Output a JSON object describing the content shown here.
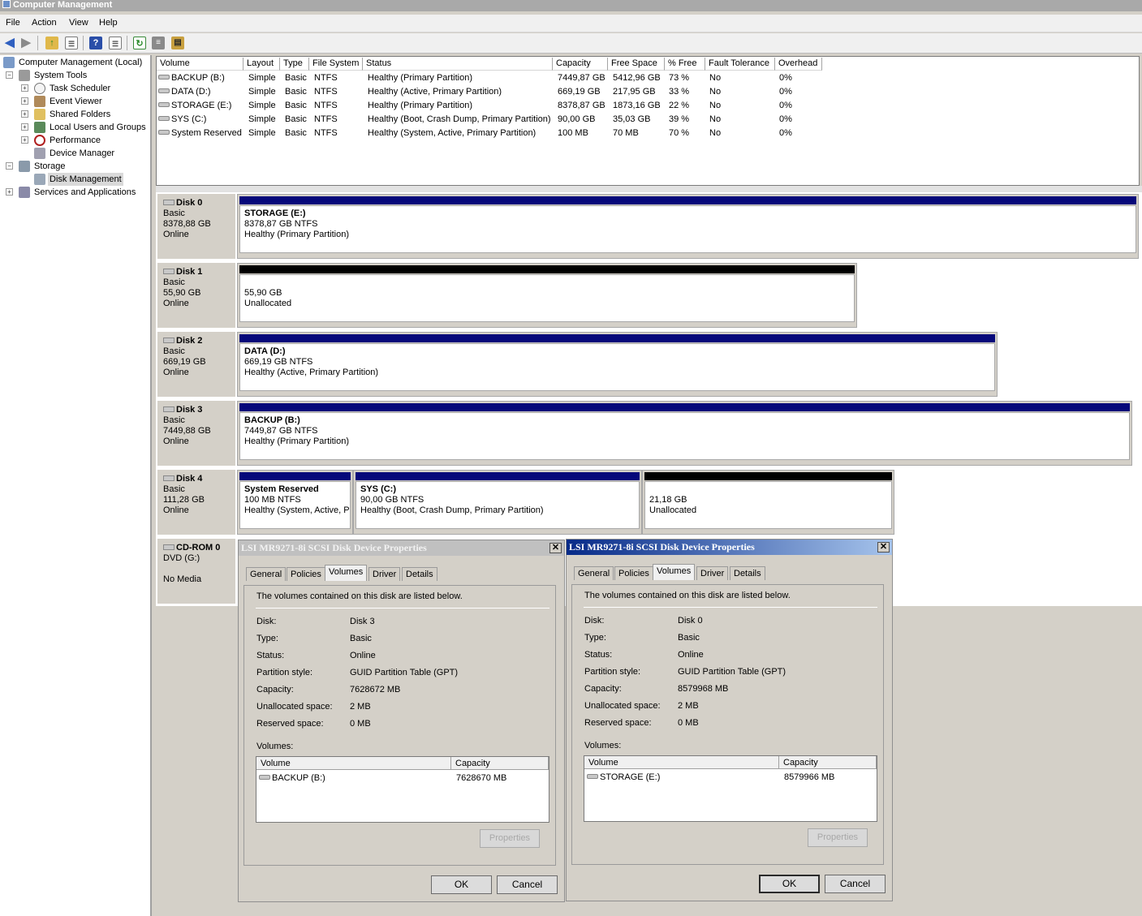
{
  "window": {
    "title": "Computer Management"
  },
  "menu": [
    "File",
    "Action",
    "View",
    "Help"
  ],
  "toolbar": {
    "icons": [
      "back-icon",
      "forward-icon",
      "up-folder-icon",
      "show-hide-tree-icon",
      "help-icon",
      "console-icon",
      "refresh-icon",
      "properties-icon",
      "export-icon"
    ]
  },
  "tree": {
    "root": "Computer Management (Local)",
    "system_tools": "System Tools",
    "task_scheduler": "Task Scheduler",
    "event_viewer": "Event Viewer",
    "shared_folders": "Shared Folders",
    "local_users": "Local Users and Groups",
    "performance": "Performance",
    "device_manager": "Device Manager",
    "storage": "Storage",
    "disk_management": "Disk Management",
    "services": "Services and Applications"
  },
  "volume_list": {
    "headers": [
      "Volume",
      "Layout",
      "Type",
      "File System",
      "Status",
      "Capacity",
      "Free Space",
      "% Free",
      "Fault Tolerance",
      "Overhead"
    ],
    "rows": [
      [
        "BACKUP (B:)",
        "Simple",
        "Basic",
        "NTFS",
        "Healthy (Primary Partition)",
        "7449,87 GB",
        "5412,96 GB",
        "73 %",
        "No",
        "0%"
      ],
      [
        "DATA (D:)",
        "Simple",
        "Basic",
        "NTFS",
        "Healthy (Active, Primary Partition)",
        "669,19 GB",
        "217,95 GB",
        "33 %",
        "No",
        "0%"
      ],
      [
        "STORAGE (E:)",
        "Simple",
        "Basic",
        "NTFS",
        "Healthy (Primary Partition)",
        "8378,87 GB",
        "1873,16 GB",
        "22 %",
        "No",
        "0%"
      ],
      [
        "SYS (C:)",
        "Simple",
        "Basic",
        "NTFS",
        "Healthy (Boot, Crash Dump, Primary Partition)",
        "90,00 GB",
        "35,03 GB",
        "39 %",
        "No",
        "0%"
      ],
      [
        "System Reserved",
        "Simple",
        "Basic",
        "NTFS",
        "Healthy (System, Active, Primary Partition)",
        "100 MB",
        "70 MB",
        "70 %",
        "No",
        "0%"
      ]
    ]
  },
  "disks": [
    {
      "name": "Disk 0",
      "type": "Basic",
      "size": "8378,88 GB",
      "state": "Online"
    },
    {
      "name": "Disk 1",
      "type": "Basic",
      "size": "55,90 GB",
      "state": "Online"
    },
    {
      "name": "Disk 2",
      "type": "Basic",
      "size": "669,19 GB",
      "state": "Online"
    },
    {
      "name": "Disk 3",
      "type": "Basic",
      "size": "7449,88 GB",
      "state": "Online"
    },
    {
      "name": "Disk 4",
      "type": "Basic",
      "size": "111,28 GB",
      "state": "Online"
    },
    {
      "name": "CD-ROM 0",
      "type": "DVD (G:)",
      "state": "No Media"
    }
  ],
  "partitions": {
    "d0p1": {
      "name": "STORAGE  (E:)",
      "size": "8378,87 GB NTFS",
      "status": "Healthy (Primary Partition)"
    },
    "d1p1": {
      "size": "55,90 GB",
      "status": "Unallocated"
    },
    "d2p1": {
      "name": "DATA  (D:)",
      "size": "669,19 GB NTFS",
      "status": "Healthy (Active, Primary Partition)"
    },
    "d3p1": {
      "name": "BACKUP  (B:)",
      "size": "7449,87 GB NTFS",
      "status": "Healthy (Primary Partition)"
    },
    "d4p1": {
      "name": "System Reserved",
      "size": "100 MB NTFS",
      "status": "Healthy (System, Active, P"
    },
    "d4p2": {
      "name": "SYS  (C:)",
      "size": "90,00 GB NTFS",
      "status": "Healthy (Boot, Crash Dump, Primary Partition)"
    },
    "d4p3": {
      "size": "21,18 GB",
      "status": "Unallocated"
    }
  },
  "dialog_labels": {
    "tabs": [
      "General",
      "Policies",
      "Volumes",
      "Driver",
      "Details"
    ],
    "intro": "The volumes contained on this disk are listed below.",
    "disk": "Disk:",
    "type": "Type:",
    "status": "Status:",
    "partition_style": "Partition style:",
    "capacity": "Capacity:",
    "unallocated": "Unallocated space:",
    "reserved": "Reserved space:",
    "volumes": "Volumes:",
    "col_volume": "Volume",
    "col_capacity": "Capacity",
    "properties": "Properties",
    "ok": "OK",
    "cancel": "Cancel"
  },
  "dialog1": {
    "title": "LSI MR9271-8i SCSI Disk Device Properties",
    "active": false,
    "disk": "Disk 3",
    "type": "Basic",
    "status": "Online",
    "partition_style": "GUID Partition Table (GPT)",
    "capacity": "7628672 MB",
    "unallocated": "2 MB",
    "reserved": "0 MB",
    "volume": "BACKUP (B:)",
    "volume_capacity": "7628670 MB"
  },
  "dialog2": {
    "title": "LSI MR9271-8i SCSI Disk Device Properties",
    "active": true,
    "disk": "Disk 0",
    "type": "Basic",
    "status": "Online",
    "partition_style": "GUID Partition Table (GPT)",
    "capacity": "8579968 MB",
    "unallocated": "2 MB",
    "reserved": "0 MB",
    "volume": "STORAGE (E:)",
    "volume_capacity": "8579966 MB"
  },
  "colors": {
    "primary_partition": "#06087a",
    "unallocated": "#000000",
    "title_active": "#062a88"
  }
}
